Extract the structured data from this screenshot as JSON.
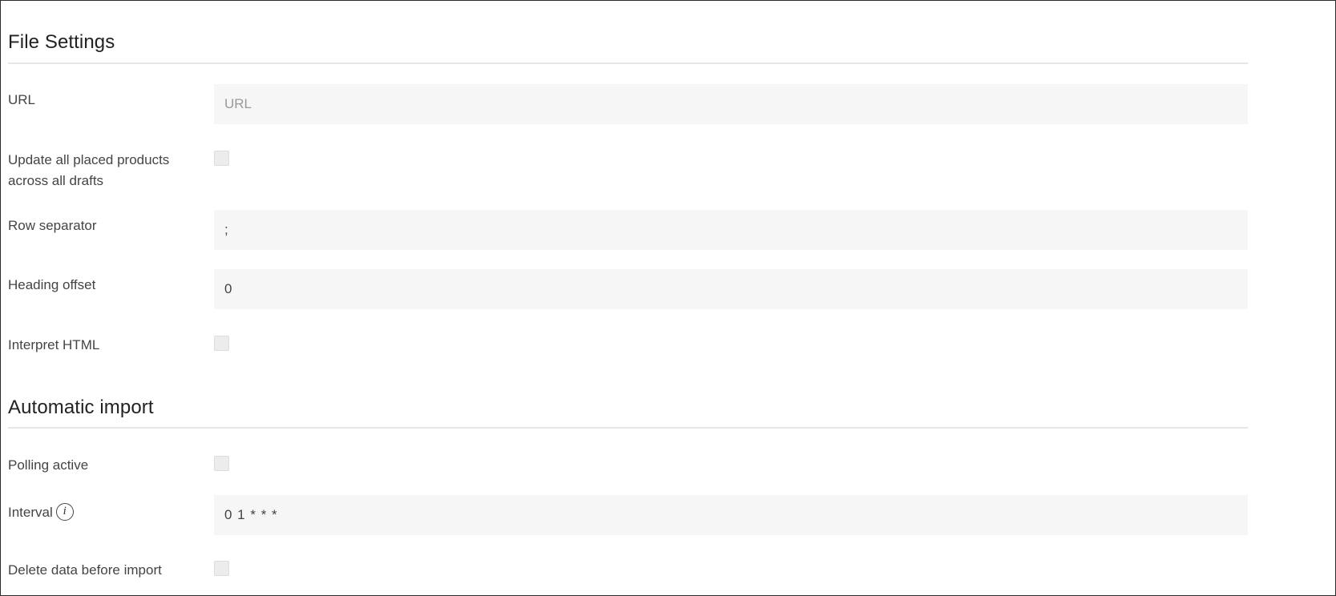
{
  "file_settings": {
    "heading": "File Settings",
    "url": {
      "label": "URL",
      "value": "",
      "placeholder": "URL"
    },
    "update_all": {
      "label": "Update all placed products across all drafts",
      "checked": false
    },
    "row_separator": {
      "label": "Row separator",
      "value": ";"
    },
    "heading_offset": {
      "label": "Heading offset",
      "value": "0"
    },
    "interpret_html": {
      "label": "Interpret HTML",
      "checked": false
    }
  },
  "automatic_import": {
    "heading": "Automatic import",
    "polling_active": {
      "label": "Polling active",
      "checked": false
    },
    "interval": {
      "label": "Interval",
      "info_icon": "info-icon",
      "info_glyph": "i",
      "value": "0 1 * * *"
    },
    "delete_data": {
      "label": "Delete data before import",
      "checked": false
    }
  }
}
